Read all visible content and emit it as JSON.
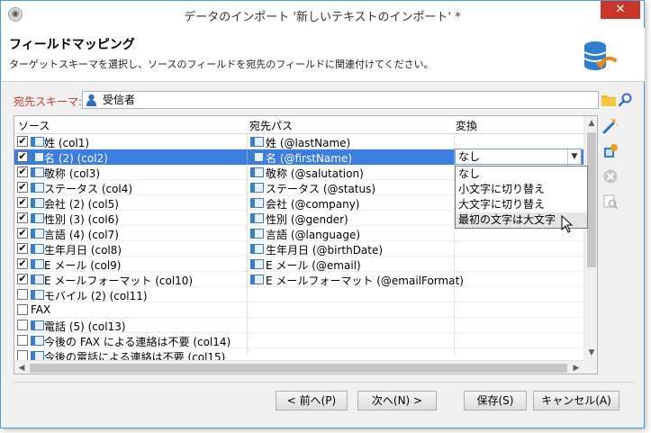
{
  "window": {
    "title": "データのインポート '新しいテキストのインポート' *",
    "close_glyph": "✕"
  },
  "header": {
    "title": "フィールドマッピング",
    "subtitle": "ターゲットスキーマを選択し、ソースのフィールドを宛先のフィールドに関連付けてください。"
  },
  "schema": {
    "label": "宛先スキーマ:",
    "value": "受信者"
  },
  "columns": {
    "source": "ソース",
    "dest": "宛先パス",
    "transform": "変換"
  },
  "rows": [
    {
      "checked": true,
      "source": "姓 (col1)",
      "dest": "姓 (@lastName)"
    },
    {
      "checked": true,
      "source": "名 (2) (col2)",
      "dest": "名 (@firstName)",
      "selected": true
    },
    {
      "checked": true,
      "source": "敬称 (col3)",
      "dest": "敬称 (@salutation)"
    },
    {
      "checked": true,
      "source": "ステータス (col4)",
      "dest": "ステータス (@status)"
    },
    {
      "checked": true,
      "source": "会社 (2) (col5)",
      "dest": "会社 (@company)"
    },
    {
      "checked": true,
      "source": "性別 (3) (col6)",
      "dest": "性別 (@gender)"
    },
    {
      "checked": true,
      "source": "言語 (4) (col7)",
      "dest": "言語 (@language)"
    },
    {
      "checked": true,
      "source": "生年月日 (col8)",
      "dest": "生年月日 (@birthDate)"
    },
    {
      "checked": true,
      "source": "E メール (col9)",
      "dest": "E メール (@email)"
    },
    {
      "checked": true,
      "source": "E メールフォーマット (col10)",
      "dest": "E メールフォーマット (@emailFormat)"
    },
    {
      "checked": false,
      "source": "モバイル (2) (col11)",
      "dest": ""
    },
    {
      "checked": false,
      "source": "FAX",
      "dest": ""
    },
    {
      "checked": false,
      "source": "電話 (5) (col13)",
      "dest": ""
    },
    {
      "checked": false,
      "source": "今後の FAX による連絡は不要 (col14)",
      "dest": ""
    },
    {
      "checked": false,
      "source": "今後の電話による連絡は不要 (col15)",
      "dest": ""
    }
  ],
  "transform": {
    "selected": "なし",
    "options": [
      "なし",
      "小文字に切り替え",
      "大文字に切り替え",
      "最初の文字は大文字"
    ],
    "hovered_index": 3
  },
  "buttons": {
    "prev": "< 前へ(P)",
    "next": "次へ(N) >",
    "save": "保存(S)",
    "cancel": "キャンセル(A)"
  },
  "colors": {
    "selection": "#3b7de0",
    "schema_label": "#c0392b",
    "close": "#c7352b"
  }
}
